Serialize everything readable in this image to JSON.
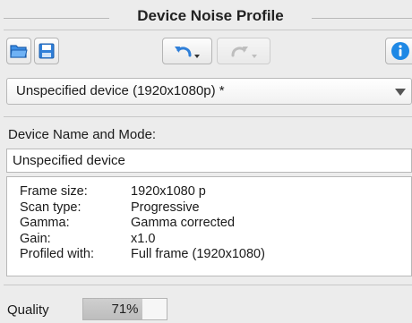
{
  "panel": {
    "title": "Device Noise Profile"
  },
  "toolbar": {
    "open_icon": "folder-open-icon",
    "save_icon": "floppy-save-icon",
    "undo_icon": "undo-arrow-icon",
    "redo_icon": "redo-arrow-icon",
    "info_icon": "info-icon"
  },
  "device_select": {
    "selected": "Unspecified device (1920x1080p) *"
  },
  "device_name": {
    "label": "Device Name and Mode:",
    "value": "Unspecified device"
  },
  "info": {
    "rows": [
      {
        "key": "Frame size:",
        "value": "1920x1080 p"
      },
      {
        "key": "Scan type:",
        "value": "Progressive"
      },
      {
        "key": "Gamma:",
        "value": "Gamma corrected"
      },
      {
        "key": "Gain:",
        "value": "x1.0"
      },
      {
        "key": "Profiled with:",
        "value": "Full frame (1920x1080)"
      }
    ]
  },
  "quality": {
    "label": "Quality",
    "percent_text": "71%",
    "level": 0.71
  },
  "colors": {
    "info_blue": "#1e88e5",
    "folder_blue": "#2f7fd8"
  }
}
